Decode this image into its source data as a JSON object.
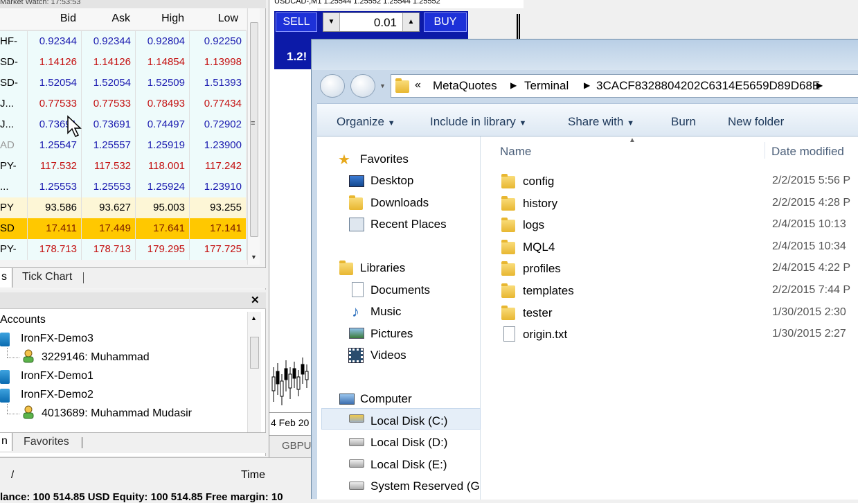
{
  "market_watch": {
    "title_partial": "Market Watch: 17:53:53",
    "columns": [
      "Bid",
      "Ask",
      "High",
      "Low"
    ],
    "rows": [
      {
        "symbol": "HF-",
        "bid": "0.92344",
        "ask": "0.92344",
        "high": "0.92804",
        "low": "0.92250",
        "color": "#1b1bb0",
        "bg": "#eefbfb"
      },
      {
        "symbol": "SD-",
        "bid": "1.14126",
        "ask": "1.14126",
        "high": "1.14854",
        "low": "1.13998",
        "color": "#c41010",
        "bg": "#eefbfb"
      },
      {
        "symbol": "SD-",
        "bid": "1.52054",
        "ask": "1.52054",
        "high": "1.52509",
        "low": "1.51393",
        "color": "#1b1bb0",
        "bg": "#eefbfb"
      },
      {
        "symbol": "J...",
        "bid": "0.77533",
        "ask": "0.77533",
        "high": "0.78493",
        "low": "0.77434",
        "color": "#c41010",
        "bg": "#eefbfb"
      },
      {
        "symbol": "J...",
        "bid": "0.73691",
        "ask": "0.73691",
        "high": "0.74497",
        "low": "0.72902",
        "color": "#1b1bb0",
        "bg": "#eefbfb"
      },
      {
        "symbol": "AD",
        "bid": "1.25547",
        "ask": "1.25557",
        "high": "1.25919",
        "low": "1.23900",
        "color": "#1b1bb0",
        "bg": "#eefbfb",
        "symbol_color": "#9a9a9a"
      },
      {
        "symbol": "PY-",
        "bid": "117.532",
        "ask": "117.532",
        "high": "118.001",
        "low": "117.242",
        "color": "#c41010",
        "bg": "#eefbfb"
      },
      {
        "symbol": "...",
        "bid": "1.25553",
        "ask": "1.25553",
        "high": "1.25924",
        "low": "1.23910",
        "color": "#1b1bb0",
        "bg": "#eefbfb"
      },
      {
        "symbol": "PY",
        "bid": "93.586",
        "ask": "93.627",
        "high": "95.003",
        "low": "93.255",
        "color": "#000000",
        "bg": "#fdf6d6"
      },
      {
        "symbol": "SD",
        "bid": "17.411",
        "ask": "17.449",
        "high": "17.641",
        "low": "17.141",
        "color": "#7a1a00",
        "bg": "#ffc800"
      },
      {
        "symbol": "PY-",
        "bid": "178.713",
        "ask": "178.713",
        "high": "179.295",
        "low": "177.725",
        "color": "#c41010",
        "bg": "#eefbfb"
      }
    ],
    "tabs": [
      "s",
      "Tick Chart"
    ]
  },
  "navigator": {
    "section": "Accounts",
    "items": [
      {
        "label": "IronFX-Demo3",
        "type": "server"
      },
      {
        "label": "3229146: Muhammad",
        "type": "account"
      },
      {
        "label": "IronFX-Demo1",
        "type": "server"
      },
      {
        "label": "IronFX-Demo2",
        "type": "server"
      },
      {
        "label": "4013689: Muhammad Mudasir",
        "type": "account"
      }
    ],
    "tabs": [
      "n",
      "Favorites"
    ]
  },
  "terminal": {
    "col_slash": "/",
    "col_time": "Time",
    "status_partial": "lance: 100 514.85 USD  Equity: 100 514.85  Free margin: 10"
  },
  "chart": {
    "header": "USDCAD-,M1  1.25544 1.25552 1.25544 1.25552",
    "sell_label": "SELL",
    "buy_label": "BUY",
    "lot_value": "0.01",
    "price_partial": "1.2!",
    "date_label": "4 Feb 20",
    "tab_label": "GBPU"
  },
  "explorer": {
    "breadcrumb": [
      "«",
      "MetaQuotes",
      "Terminal",
      "3CACF8328804202C6314E5659D89D68E"
    ],
    "toolbar": [
      "Organize",
      "Include in library",
      "Share with",
      "Burn",
      "New folder"
    ],
    "favorites": {
      "header": "Favorites",
      "items": [
        "Desktop",
        "Downloads",
        "Recent Places"
      ]
    },
    "libraries": {
      "header": "Libraries",
      "items": [
        "Documents",
        "Music",
        "Pictures",
        "Videos"
      ]
    },
    "computer": {
      "header": "Computer",
      "items": [
        "Local Disk (C:)",
        "Local Disk (D:)",
        "Local Disk (E:)",
        "System Reserved (G:"
      ]
    },
    "columns": {
      "name": "Name",
      "date": "Date modified"
    },
    "files": [
      {
        "name": "config",
        "date": "2/2/2015 5:56 P",
        "type": "folder"
      },
      {
        "name": "history",
        "date": "2/2/2015 4:28 P",
        "type": "folder"
      },
      {
        "name": "logs",
        "date": "2/4/2015 10:13",
        "type": "folder"
      },
      {
        "name": "MQL4",
        "date": "2/4/2015 10:34",
        "type": "folder"
      },
      {
        "name": "profiles",
        "date": "2/4/2015 4:22 P",
        "type": "folder"
      },
      {
        "name": "templates",
        "date": "2/2/2015 7:44 P",
        "type": "folder"
      },
      {
        "name": "tester",
        "date": "1/30/2015 2:30",
        "type": "folder"
      },
      {
        "name": "origin.txt",
        "date": "1/30/2015 2:27",
        "type": "file"
      }
    ]
  }
}
